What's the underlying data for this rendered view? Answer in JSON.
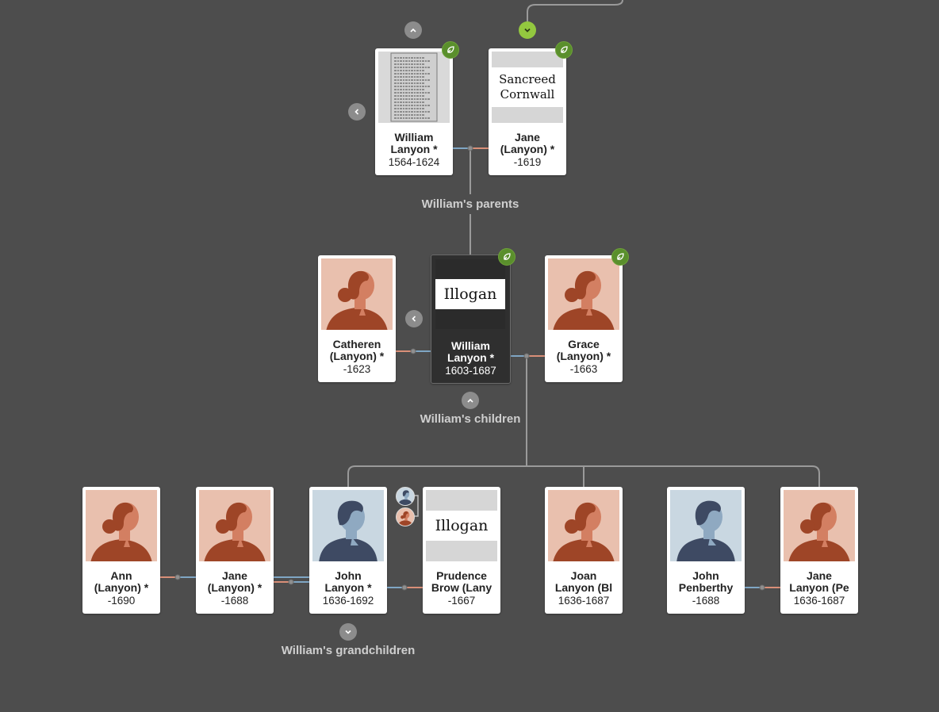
{
  "colors": {
    "background": "#4d4d4d",
    "line": "#9a9a9a",
    "male_line": "#7fa6c4",
    "female_line": "#d98f78",
    "badge": "#5a8f2c",
    "female_bg": "#e9c0ae",
    "male_bg": "#c9d7e1"
  },
  "labels": {
    "parents": "William's parents",
    "children": "William's children",
    "grandchildren": "William's grandchildren"
  },
  "persons": {
    "william_sr": {
      "name": "William\nLanyon *",
      "dates": "1564-1624",
      "photo": "document"
    },
    "jane_sr": {
      "name": "Jane\n(Lanyon) *",
      "dates": "-1619",
      "photo": "place",
      "place_text": "Sancreed\nCornwall"
    },
    "catheren": {
      "name": "Catheren\n(Lanyon) *",
      "dates": "-1623",
      "photo": "female"
    },
    "william": {
      "name": "William\nLanyon *",
      "dates": "1603-1687",
      "photo": "place",
      "place_text": "Illogan"
    },
    "grace": {
      "name": "Grace\n(Lanyon) *",
      "dates": "-1663",
      "photo": "female"
    },
    "ann": {
      "name": "Ann\n(Lanyon) *",
      "dates": "-1690",
      "photo": "female"
    },
    "jane_b": {
      "name": "Jane\n(Lanyon) *",
      "dates": "-1688",
      "photo": "female"
    },
    "john": {
      "name": "John\nLanyon *",
      "dates": "1636-1692",
      "photo": "male"
    },
    "prudence": {
      "name": "Prudence\nBrow (Lany",
      "dates": "-1667",
      "photo": "place",
      "place_text": "Illogan"
    },
    "joan": {
      "name": "Joan\nLanyon (Bl",
      "dates": "1636-1687",
      "photo": "female"
    },
    "john_p": {
      "name": "John\nPenberthy",
      "dates": "-1688",
      "photo": "male"
    },
    "jane_p": {
      "name": "Jane\nLanyon (Pe",
      "dates": "1636-1687",
      "photo": "female"
    }
  },
  "icons": {
    "badge": "hint-leaf-icon",
    "up": "chevron-up-icon",
    "down": "chevron-down-icon",
    "left": "chevron-left-icon"
  }
}
